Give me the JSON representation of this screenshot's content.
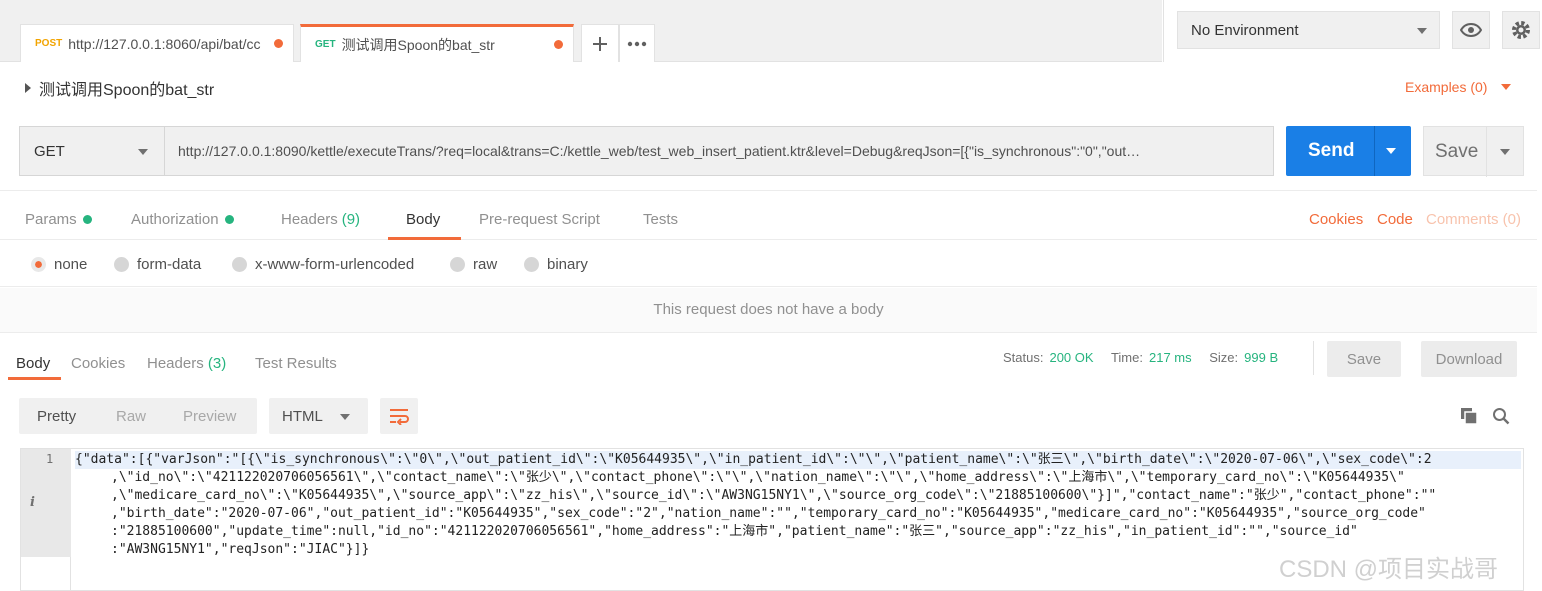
{
  "tabs": [
    {
      "method": "POST",
      "method_color": "#f2a400",
      "name": "http://127.0.0.1:8060/api/bat/cc"
    },
    {
      "method": "GET",
      "method_color": "#26b47f",
      "name": "测试调用Spoon的bat_str"
    }
  ],
  "environment": {
    "selected": "No Environment"
  },
  "request": {
    "title": "测试调用Spoon的bat_str",
    "examples_label": "Examples (0)",
    "method": "GET",
    "url": "http://127.0.0.1:8090/kettle/executeTrans/?req=local&trans=C:/kettle_web/test_web_insert_patient.ktr&level=Debug&reqJson=[{\"is_synchronous\":\"0\",\"out…",
    "send_label": "Send",
    "save_label": "Save"
  },
  "request_tabs": {
    "params": "Params",
    "authorization": "Authorization",
    "headers": "Headers",
    "headers_count": "(9)",
    "body": "Body",
    "prerequest": "Pre-request Script",
    "tests": "Tests",
    "cookies": "Cookies",
    "code": "Code",
    "comments": "Comments (0)"
  },
  "body_types": [
    "none",
    "form-data",
    "x-www-form-urlencoded",
    "raw",
    "binary"
  ],
  "no_body_message": "This request does not have a body",
  "response_tabs": {
    "body": "Body",
    "cookies": "Cookies",
    "headers": "Headers",
    "headers_count": "(3)",
    "test_results": "Test Results"
  },
  "status": {
    "status_label": "Status:",
    "status_value": "200 OK",
    "time_label": "Time:",
    "time_value": "217 ms",
    "size_label": "Size:",
    "size_value": "999 B"
  },
  "response_actions": {
    "save": "Save",
    "download": "Download"
  },
  "formats": {
    "pretty": "Pretty",
    "raw": "Raw",
    "preview": "Preview",
    "language": "HTML"
  },
  "editor": {
    "line_number": "1",
    "info_marker": "i",
    "lines": [
      "{\"data\":[{\"varJson\":\"[{\\\"is_synchronous\\\":\\\"0\\\",\\\"out_patient_id\\\":\\\"K05644935\\\",\\\"in_patient_id\\\":\\\"\\\",\\\"patient_name\\\":\\\"张三\\\",\\\"birth_date\\\":\\\"2020-07-06\\\",\\\"sex_code\\\":2",
      ",\\\"id_no\\\":\\\"421122020706056561\\\",\\\"contact_name\\\":\\\"张少\\\",\\\"contact_phone\\\":\\\"\\\",\\\"nation_name\\\":\\\"\\\",\\\"home_address\\\":\\\"上海市\\\",\\\"temporary_card_no\\\":\\\"K05644935\\\"",
      ",\\\"medicare_card_no\\\":\\\"K05644935\\\",\\\"source_app\\\":\\\"zz_his\\\",\\\"source_id\\\":\\\"AW3NG15NY1\\\",\\\"source_org_code\\\":\\\"21885100600\\\"}]\",\"contact_name\":\"张少\",\"contact_phone\":\"\"",
      ",\"birth_date\":\"2020-07-06\",\"out_patient_id\":\"K05644935\",\"sex_code\":\"2\",\"nation_name\":\"\",\"temporary_card_no\":\"K05644935\",\"medicare_card_no\":\"K05644935\",\"source_org_code\"",
      ":\"21885100600\",\"update_time\":null,\"id_no\":\"421122020706056561\",\"home_address\":\"上海市\",\"patient_name\":\"张三\",\"source_app\":\"zz_his\",\"in_patient_id\":\"\",\"source_id\"",
      ":\"AW3NG15NY1\",\"reqJson\":\"JIAC\"}]}"
    ]
  },
  "watermark": "CSDN @项目实战哥",
  "colors": {
    "accent": "#f26b3a",
    "send": "#1a7fe6",
    "success": "#26b47f"
  }
}
